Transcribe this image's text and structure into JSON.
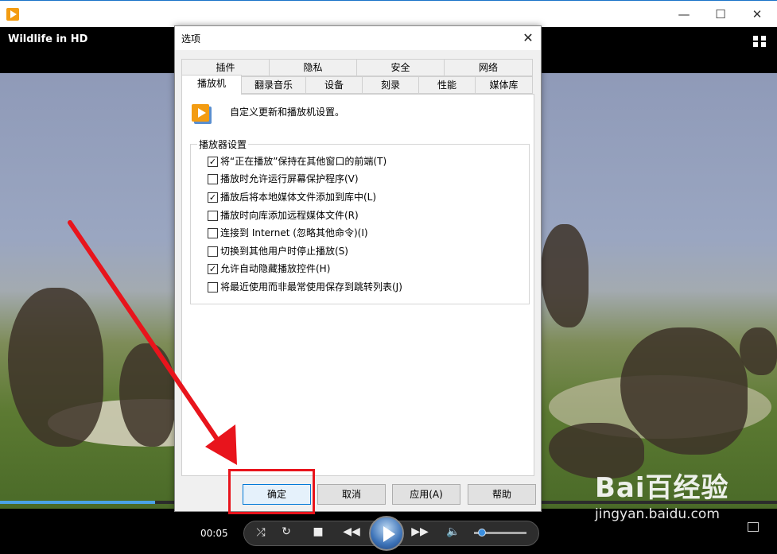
{
  "window": {
    "minimize": "—",
    "maximize": "☐",
    "close": "✕"
  },
  "player": {
    "video_title": "Wildlife in HD",
    "time": "00:05",
    "progress": 0.2,
    "volume": 0.15
  },
  "watermark": {
    "brand": "Bai百经验",
    "url": "jingyan.baidu.com"
  },
  "dialog": {
    "title": "选项",
    "close": "✕",
    "tabs_top": [
      "插件",
      "隐私",
      "安全",
      "网络"
    ],
    "tabs_bottom": [
      "播放机",
      "翻录音乐",
      "设备",
      "刻录",
      "性能",
      "媒体库"
    ],
    "active_tab": "播放机",
    "description": "自定义更新和播放机设置。",
    "group_label": "播放器设置",
    "options": [
      {
        "label": "将“正在播放”保持在其他窗口的前端(T)",
        "checked": true
      },
      {
        "label": "播放时允许运行屏幕保护程序(V)",
        "checked": false
      },
      {
        "label": "播放后将本地媒体文件添加到库中(L)",
        "checked": true
      },
      {
        "label": "播放时向库添加远程媒体文件(R)",
        "checked": false
      },
      {
        "label": "连接到 Internet (忽略其他命令)(I)",
        "checked": false
      },
      {
        "label": "切换到其他用户时停止播放(S)",
        "checked": false
      },
      {
        "label": "允许自动隐藏播放控件(H)",
        "checked": true
      },
      {
        "label": "将最近使用而非最常使用保存到跳转列表(J)",
        "checked": false
      }
    ],
    "buttons": {
      "ok": "确定",
      "cancel": "取消",
      "apply": "应用(A)",
      "help": "帮助"
    }
  },
  "colors": {
    "highlight": "#e8141c",
    "accent": "#0078d7"
  }
}
